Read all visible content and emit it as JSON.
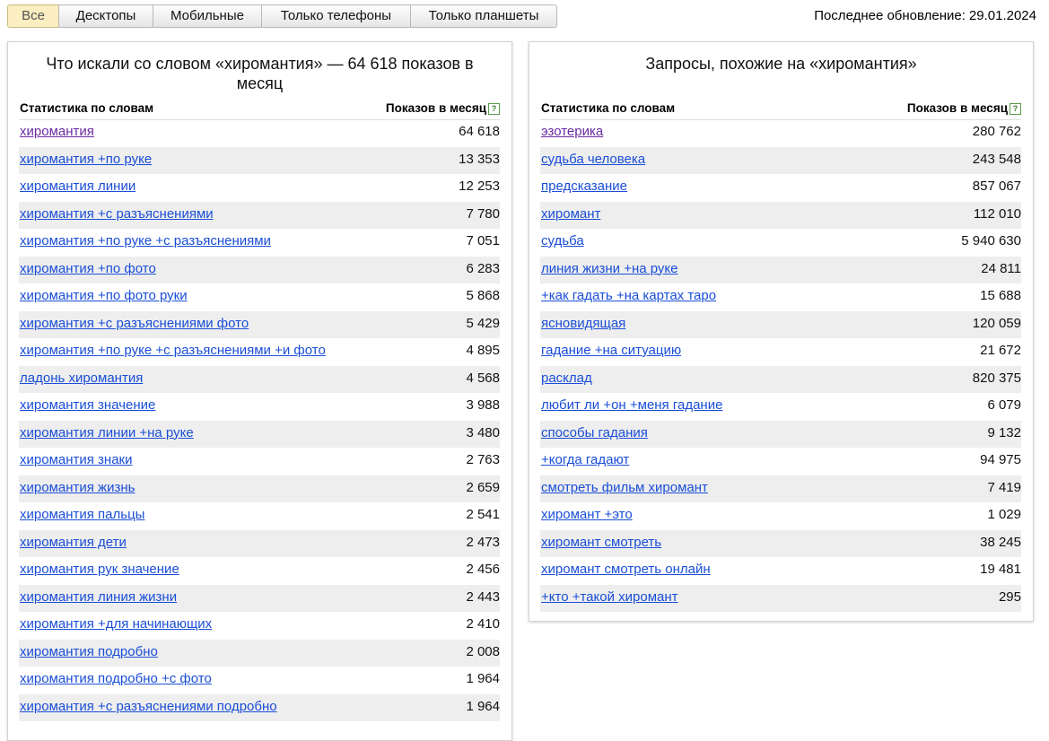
{
  "tabs": [
    "Все",
    "Десктопы",
    "Мобильные",
    "Только телефоны",
    "Только планшеты"
  ],
  "update": {
    "label": "Последнее обновление:",
    "date": "29.01.2024"
  },
  "left": {
    "title": "Что искали со словом «хиромантия» — 64 618 показов в месяц",
    "col_words": "Статистика по словам",
    "col_shows": "Показов в месяц",
    "rows": [
      {
        "q": "хиромантия",
        "n": "64 618"
      },
      {
        "q": "хиромантия +по руке",
        "n": "13 353"
      },
      {
        "q": "хиромантия линии",
        "n": "12 253"
      },
      {
        "q": "хиромантия +с разъяснениями",
        "n": "7 780"
      },
      {
        "q": "хиромантия +по руке +с разъяснениями",
        "n": "7 051"
      },
      {
        "q": "хиромантия +по фото",
        "n": "6 283"
      },
      {
        "q": "хиромантия +по фото руки",
        "n": "5 868"
      },
      {
        "q": "хиромантия +с разъяснениями фото",
        "n": "5 429"
      },
      {
        "q": "хиромантия +по руке +с разъяснениями +и фото",
        "n": "4 895"
      },
      {
        "q": "ладонь хиромантия",
        "n": "4 568"
      },
      {
        "q": "хиромантия значение",
        "n": "3 988"
      },
      {
        "q": "хиромантия линии +на руке",
        "n": "3 480"
      },
      {
        "q": "хиромантия знаки",
        "n": "2 763"
      },
      {
        "q": "хиромантия жизнь",
        "n": "2 659"
      },
      {
        "q": "хиромантия пальцы",
        "n": "2 541"
      },
      {
        "q": "хиромантия дети",
        "n": "2 473"
      },
      {
        "q": "хиромантия рук значение",
        "n": "2 456"
      },
      {
        "q": "хиромантия линия жизни",
        "n": "2 443"
      },
      {
        "q": "хиромантия +для начинающих",
        "n": "2 410"
      },
      {
        "q": "хиромантия подробно",
        "n": "2 008"
      },
      {
        "q": "хиромантия подробно +с фото",
        "n": "1 964"
      },
      {
        "q": "хиромантия +с разъяснениями подробно",
        "n": "1 964"
      }
    ]
  },
  "right": {
    "title": "Запросы, похожие на «хиромантия»",
    "col_words": "Статистика по словам",
    "col_shows": "Показов в месяц",
    "rows": [
      {
        "q": "эзотерика",
        "n": "280 762"
      },
      {
        "q": "судьба человека",
        "n": "243 548"
      },
      {
        "q": "предсказание",
        "n": "857 067"
      },
      {
        "q": "хиромант",
        "n": "112 010"
      },
      {
        "q": "судьба",
        "n": "5 940 630"
      },
      {
        "q": "линия жизни +на руке",
        "n": "24 811"
      },
      {
        "q": "+как гадать +на картах таро",
        "n": "15 688"
      },
      {
        "q": "ясновидящая",
        "n": "120 059"
      },
      {
        "q": "гадание +на ситуацию",
        "n": "21 672"
      },
      {
        "q": "расклад",
        "n": "820 375"
      },
      {
        "q": "любит ли +он +меня гадание",
        "n": "6 079"
      },
      {
        "q": "способы гадания",
        "n": "9 132"
      },
      {
        "q": "+когда гадают",
        "n": "94 975"
      },
      {
        "q": "смотреть фильм хиромант",
        "n": "7 419"
      },
      {
        "q": "хиромант +это",
        "n": "1 029"
      },
      {
        "q": "хиромант смотреть",
        "n": "38 245"
      },
      {
        "q": "хиромант смотреть онлайн",
        "n": "19 481"
      },
      {
        "q": "+кто +такой хиромант",
        "n": "295"
      }
    ]
  }
}
